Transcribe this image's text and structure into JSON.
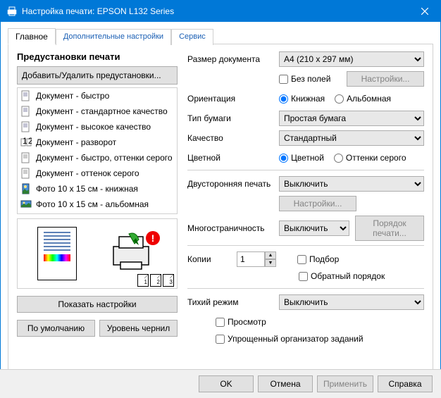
{
  "window": {
    "title": "Настройка печати: EPSON L132 Series"
  },
  "tabs": {
    "main": "Главное",
    "advanced": "Дополнительные настройки",
    "service": "Сервис"
  },
  "left": {
    "section_title": "Предустановки печати",
    "add_remove": "Добавить/Удалить предустановки...",
    "presets": [
      "Документ - быстро",
      "Документ - стандартное качество",
      "Документ - высокое качество",
      "Документ - разворот",
      "Документ - быстро, оттенки серого",
      "Документ - оттенок серого",
      "Фото 10 х 15 см - книжная",
      "Фото 10 х 15 см - альбомная"
    ],
    "show_settings": "Показать настройки",
    "defaults": "По умолчанию",
    "ink_levels": "Уровень чернил"
  },
  "right": {
    "doc_size_label": "Размер документа",
    "doc_size_value": "A4 (210 x 297 мм)",
    "borderless": "Без полей",
    "settings_btn": "Настройки...",
    "orientation_label": "Ориентация",
    "orientation_portrait": "Книжная",
    "orientation_landscape": "Альбомная",
    "paper_type_label": "Тип бумаги",
    "paper_type_value": "Простая бумага",
    "quality_label": "Качество",
    "quality_value": "Стандартный",
    "color_label": "Цветной",
    "color_color": "Цветной",
    "color_gray": "Оттенки серого",
    "duplex_label": "Двусторонняя печать",
    "duplex_value": "Выключить",
    "duplex_settings": "Настройки...",
    "multipage_label": "Многостраничность",
    "multipage_value": "Выключить",
    "print_order": "Порядок печати...",
    "copies_label": "Копии",
    "copies_value": "1",
    "collate": "Подбор",
    "reverse": "Обратный порядок",
    "quiet_label": "Тихий режим",
    "quiet_value": "Выключить",
    "preview_chk": "Просмотр",
    "simple_org": "Упрощенный организатор заданий"
  },
  "footer": {
    "ok": "OK",
    "cancel": "Отмена",
    "apply": "Применить",
    "help": "Справка"
  }
}
